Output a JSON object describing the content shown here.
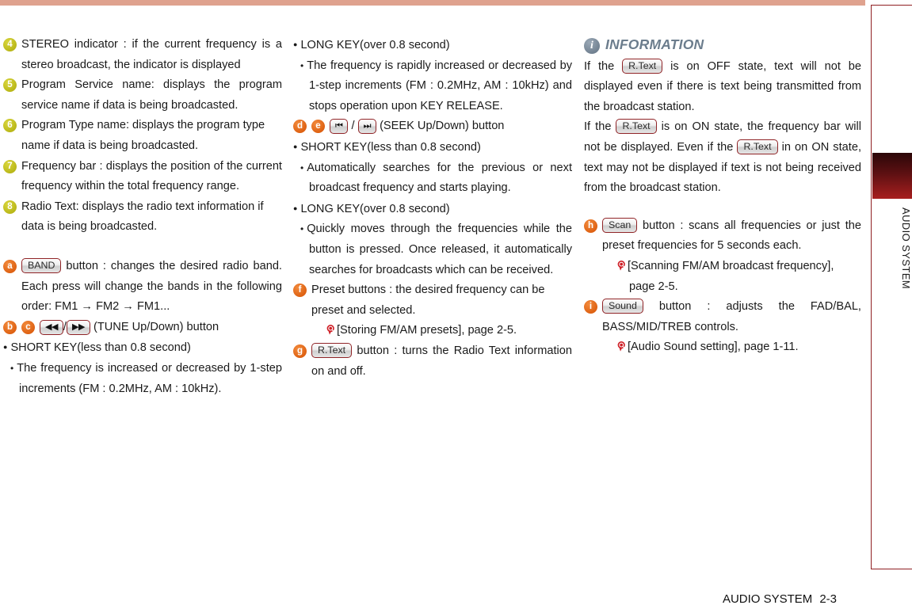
{
  "document": {
    "chapter_tab_label": "AUDIO SYSTEM",
    "footer_section": "AUDIO SYSTEM",
    "footer_page": "2-3"
  },
  "colors": {
    "topbar": "#dfa28e",
    "sidebar_rule": "#8f1f22",
    "sidebar_tab": "#a81f1f",
    "badge_number": "#b8b617",
    "badge_letter": "#dd5f10",
    "info_heading": "#6c7d8d",
    "key_border": "#8f2326",
    "reference_icon": "#cf2027"
  },
  "keys": {
    "band": "BAND",
    "rtext": "R.Text",
    "scan": "Scan",
    "sound": "Sound",
    "tune_down_icon": "rewind-icon",
    "tune_up_icon": "fast-forward-icon",
    "seek_down_icon": "skip-previous-icon",
    "seek_up_icon": "skip-next-icon"
  },
  "column1": {
    "numbered_items": [
      {
        "badge": "4",
        "text": "STEREO indicator : if the current frequency is a stereo broadcast, the indicator is displayed"
      },
      {
        "badge": "5",
        "text": "Program Service name: displays the program service name if data is being broadcasted."
      },
      {
        "badge": "6",
        "text": "Program Type name: displays the program type name if data is being broadcasted."
      },
      {
        "badge": "7",
        "text": "Frequency bar : displays the position of the current frequency within the total frequency range."
      },
      {
        "badge": "8",
        "text": "Radio Text: displays the radio text information if data is being broadcasted."
      }
    ],
    "item_a": {
      "badge": "a",
      "key": "BAND",
      "text": "button : changes the desired radio band. Each press will change the bands in the following order: FM1 → FM2 → FM1..."
    },
    "item_bc": {
      "badge_b": "b",
      "badge_c": "c",
      "separator": "/",
      "text": "(TUNE Up/Down) button"
    },
    "short_key_heading": "SHORT KEY(less than 0.8 second)",
    "short_key_text": "The frequency is increased or decreased by 1-step increments (FM : 0.2MHz, AM : 10kHz)."
  },
  "column2": {
    "long_key_heading": "LONG KEY(over 0.8 second)",
    "long_key_text": "The frequency is rapidly increased or decreased by 1-step increments (FM : 0.2MHz, AM : 10kHz) and stops operation upon KEY RELEASE.",
    "item_de": {
      "badge_d": "d",
      "badge_e": "e",
      "separator": "/",
      "text": "(SEEK Up/Down) button"
    },
    "short_key_heading": "SHORT KEY(less than 0.8 second)",
    "short_key_text": "Automatically searches for the previous or next broadcast frequency and starts playing.",
    "long_key_heading2": "LONG KEY(over 0.8 second)",
    "long_key_text2": "Quickly moves through the frequencies while the button is pressed. Once released, it automatically searches for broadcasts which can be received.",
    "item_f": {
      "badge": "f",
      "text": "Preset buttons : the desired frequency can be preset and selected.",
      "reference": "[Storing FM/AM presets], page 2-5."
    },
    "item_g": {
      "badge": "g",
      "key": "R.Text",
      "text": "button : turns the Radio Text information on and off."
    }
  },
  "column3": {
    "info_title": "INFORMATION",
    "info_para1_pre": "If the",
    "info_para1_key": "R.Text",
    "info_para1_post": "is on OFF state, text will not be displayed even if there is text being transmitted from the broadcast station.",
    "info_para2_pre": "If the",
    "info_para2_key1": "R.Text",
    "info_para2_mid": "is on ON state, the frequency bar will not be displayed. Even if the",
    "info_para2_key2": "R.Text",
    "info_para2_post": "in on ON state, text may not be displayed if text is not being received from the broadcast station.",
    "item_h": {
      "badge": "h",
      "key": "Scan",
      "text": "button : scans all frequencies or just the preset frequencies for 5 seconds each.",
      "reference": "[Scanning FM/AM broadcast frequency], page 2-5."
    },
    "item_i": {
      "badge": "i",
      "key": "Sound",
      "text": "button : adjusts the FAD/BAL, BASS/MID/TREB controls.",
      "reference": "[Audio Sound setting], page 1-11."
    }
  }
}
